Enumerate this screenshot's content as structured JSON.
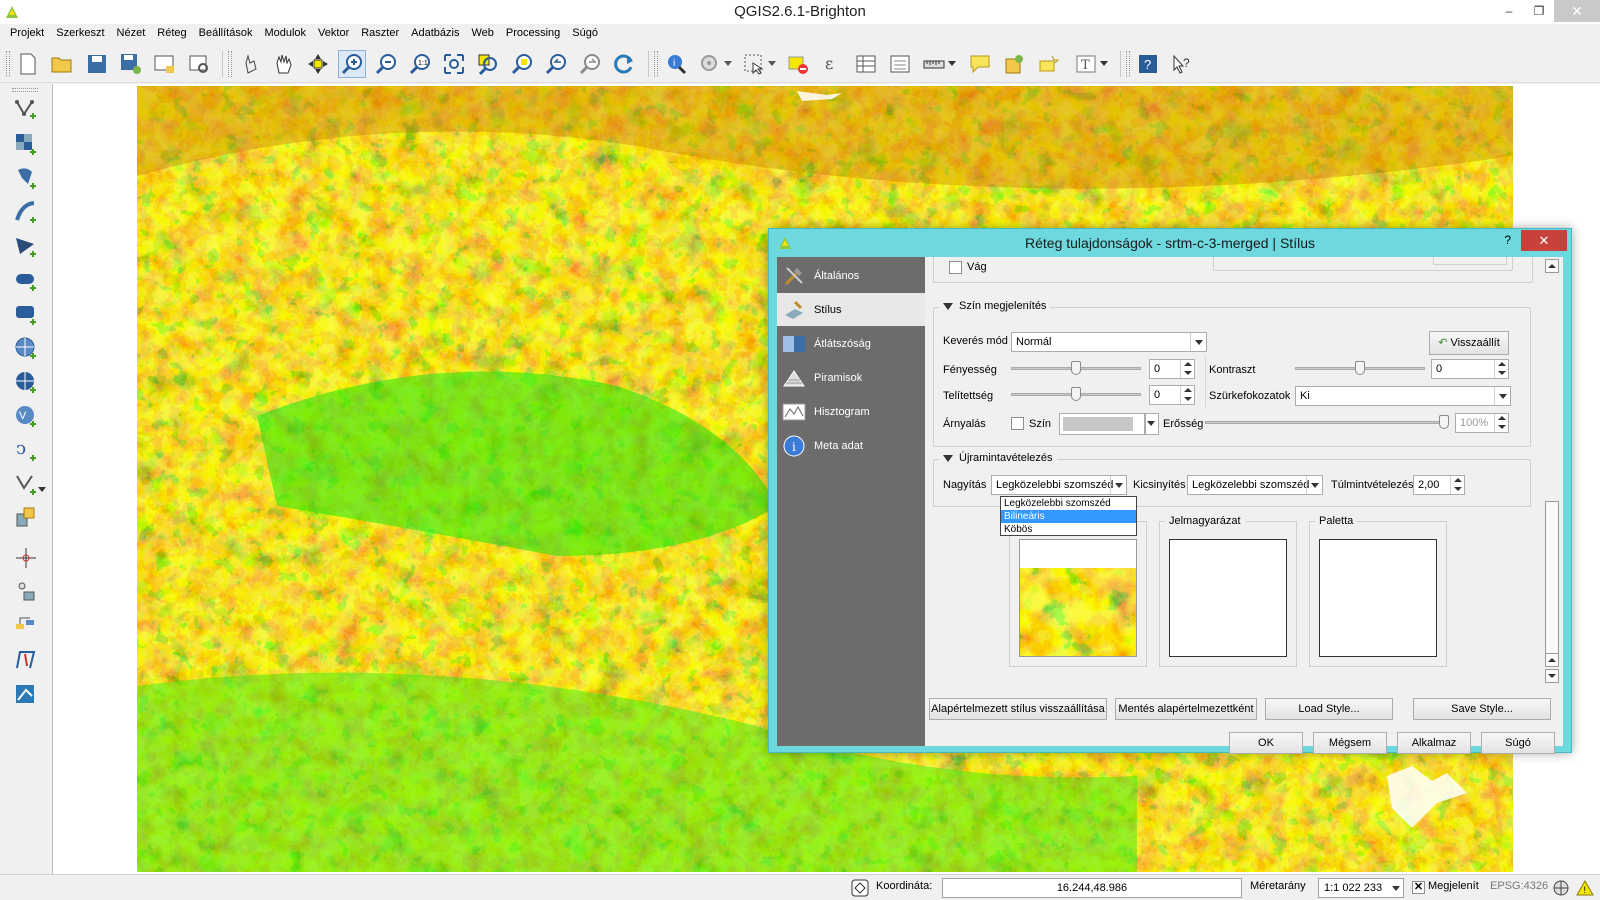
{
  "window": {
    "title": "QGIS2.6.1-Brighton",
    "min": "–",
    "max": "❐",
    "close": "✕"
  },
  "menu": [
    "Projekt",
    "Szerkeszt",
    "Nézet",
    "Réteg",
    "Beállítások",
    "Modulok",
    "Vektor",
    "Raszter",
    "Adatbázis",
    "Web",
    "Processing",
    "Súgó"
  ],
  "toolbar_icons": [
    "new-project-icon",
    "open-project-icon",
    "save-project-icon",
    "save-as-icon",
    "new-print-composer-icon",
    "composer-manager-icon",
    "touch-zoom-icon",
    "pan-icon",
    "pan-to-selection-icon",
    "zoom-in-icon",
    "zoom-out-icon",
    "zoom-actual-size-icon",
    "zoom-full-icon",
    "zoom-to-layer-icon",
    "zoom-to-selection-icon",
    "zoom-last-icon",
    "zoom-next-icon",
    "refresh-icon",
    "identify-icon",
    "action-icon",
    "select-icon",
    "deselect-icon",
    "field-calculator-icon",
    "attribute-table-icon",
    "statistics-icon",
    "measure-icon",
    "annotation-icon",
    "bookmark-icon",
    "spatial-bookmarks-icon",
    "text-annotation-icon",
    "help-icon",
    "whats-this-icon"
  ],
  "left_icons": [
    "add-vector-layer-icon",
    "add-raster-layer-icon",
    "add-postgis-layer-icon",
    "add-spatialite-layer-icon",
    "add-mssql-layer-icon",
    "add-oracle-layer-icon",
    "add-wms-layer-icon",
    "add-wcs-layer-icon",
    "add-wfs-layer-icon",
    "add-delimited-text-icon",
    "new-shapefile-icon",
    "add-virtual-layer-icon",
    "georeferencer-icon",
    "gps-tools-icon",
    "coordinate-capture-icon",
    "qgis-cloud-icon",
    "road-graph-icon"
  ],
  "dialog": {
    "title": "Réteg tulajdonságok - srtm-c-3-merged | Stílus",
    "help": "?",
    "close": "✕",
    "sidebar": [
      {
        "label": "Általános",
        "icon": "general-tools-icon"
      },
      {
        "label": "Stílus",
        "icon": "style-brush-icon"
      },
      {
        "label": "Átlátszóság",
        "icon": "transparency-icon"
      },
      {
        "label": "Piramisok",
        "icon": "pyramids-icon"
      },
      {
        "label": "Hisztogram",
        "icon": "histogram-icon"
      },
      {
        "label": "Meta adat",
        "icon": "metadata-info-icon"
      }
    ],
    "selected_tab": "Stílus",
    "top_partial": {
      "clip_label": "Vág"
    },
    "color_render": {
      "title": "Szín megjelenítés",
      "blend_label": "Keverés mód",
      "blend_value": "Normál",
      "reset_button": "Visszaállít",
      "brightness_label": "Fényesség",
      "brightness_value": "0",
      "brightness_level": 0.5,
      "contrast_label": "Kontraszt",
      "contrast_value": "0",
      "contrast_level": 0.5,
      "saturation_label": "Telítettség",
      "saturation_value": "0",
      "saturation_level": 0.5,
      "grayscale_label": "Szürkefokozatok",
      "grayscale_value": "Ki",
      "hue_label": "Árnyalás",
      "color_label": "Szín",
      "strength_label": "Erősség",
      "strength_value": "100%",
      "strength_level": 1.0
    },
    "resampling": {
      "title": "Újramintavételezés",
      "zoom_in_label": "Nagyítás",
      "zoom_in_value": "Legközelebbi szomszéd",
      "zoom_out_label": "Kicsinyítés",
      "zoom_out_value": "Legközelebbi szomszéd",
      "oversampling_label": "Túlmintvételezés",
      "oversampling_value": "2,00",
      "options": [
        "Legközelebbi szomszéd",
        "Bilineáris",
        "Köbös"
      ],
      "highlighted_option": "Bilineáris"
    },
    "previews": {
      "legend_label": "Jelmagyarázat",
      "palette_label": "Paletta"
    },
    "style_buttons": [
      "Alapértelmezett stílus visszaállítása",
      "Mentés alapértelmezettként",
      "Load Style...",
      "Save Style..."
    ],
    "buttons": {
      "ok": "OK",
      "cancel": "Mégsem",
      "apply": "Alkalmaz",
      "help": "Súgó"
    }
  },
  "statusbar": {
    "coord_label": "Koordináta:",
    "coord_value": "16.244,48.986",
    "scale_label": "Méretarány",
    "scale_value": "1:1 022 233",
    "render_label": "Megjelenít",
    "crs": "EPSG:4326"
  },
  "colors": {
    "accent_dialog": "#6ed8df",
    "sidebar": "#6c6c6c",
    "dem_low": "#22ee11",
    "dem_mid": "#f0a000",
    "dem_high": "#4a2a08",
    "highlight": "#3399ff"
  }
}
